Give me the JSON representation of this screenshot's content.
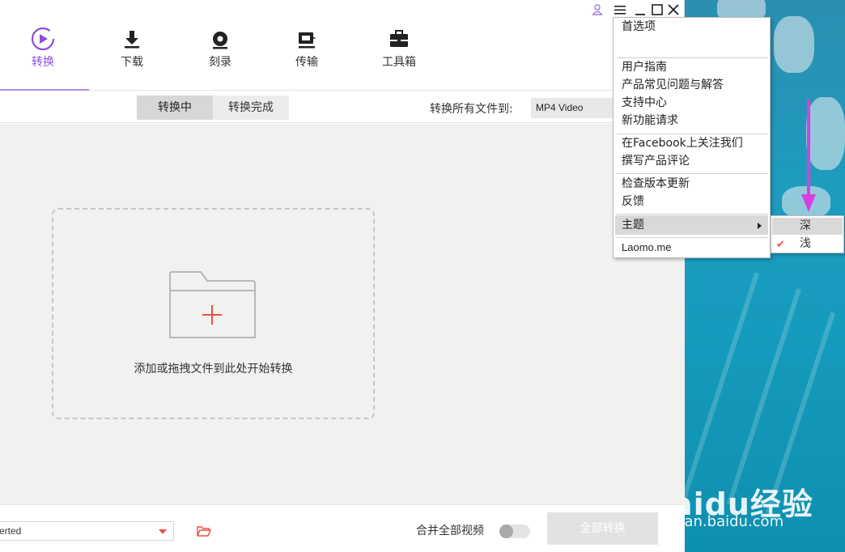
{
  "nav": {
    "items": [
      {
        "label": "转换"
      },
      {
        "label": "下载"
      },
      {
        "label": "刻录"
      },
      {
        "label": "传输"
      },
      {
        "label": "工具箱"
      }
    ]
  },
  "tabs": {
    "converting": "转换中",
    "completed": "转换完成"
  },
  "convert_to": {
    "label": "转换所有文件到:",
    "value": "MP4 Video"
  },
  "dropzone": {
    "text": "添加或拖拽文件到此处开始转换"
  },
  "bottom": {
    "output_value": "erted",
    "merge_label": "合并全部视频",
    "convert_all": "全部转换",
    "merge_on": false
  },
  "menu": {
    "items": [
      "首选项",
      "用户指南",
      "产品常见问题与解答",
      "支持中心",
      "新功能请求",
      "在Facebook上关注我们",
      "撰写产品评论",
      "检查版本更新",
      "反馈",
      "主题",
      "Laomo.me"
    ]
  },
  "theme_submenu": {
    "dark": "深",
    "light": "浅",
    "selected": "浅"
  },
  "watermark": {
    "main": "Baidu经验",
    "sub": "jingyan.baidu.com"
  },
  "colors": {
    "accent": "#8d4ddc",
    "danger": "#e8504a",
    "arrow": "#d93fe0"
  }
}
